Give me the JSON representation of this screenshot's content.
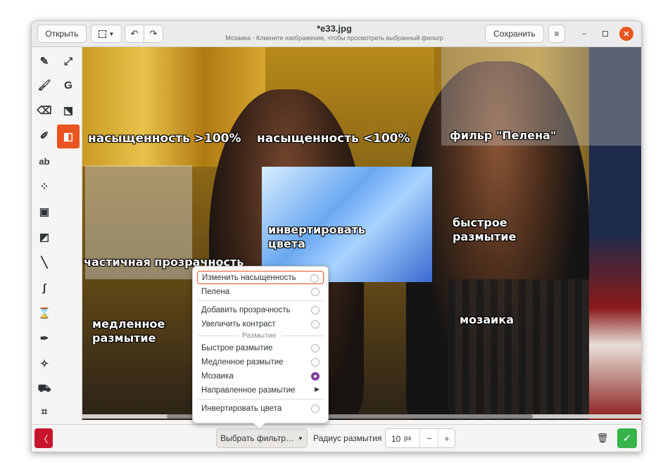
{
  "header": {
    "open_label": "Открыть",
    "save_label": "Сохранить",
    "title": "*e33.jpg",
    "subtitle": "Мозаика - Кликните изображение, чтобы просмотреть выбранный фильтр"
  },
  "canvas_labels": {
    "saturation_up": "насыщенность >100%",
    "saturation_down": "насыщенность <100%",
    "veil": "фильр \"Пелена\"",
    "invert_line1": "инвертировать",
    "invert_line2": "цвета",
    "fast_blur_line1": "быстрое",
    "fast_blur_line2": "размытие",
    "partial_transparency": "частичная прозрачность",
    "slow_blur_line1": "медленное",
    "slow_blur_line2": "размытие",
    "mosaic": "мозаика"
  },
  "filter_menu": {
    "items": [
      {
        "label": "Изменить насыщенность"
      },
      {
        "label": "Пелена"
      },
      {
        "label": "Добавить прозрачность"
      },
      {
        "label": "Увеличить контраст"
      },
      {
        "label": "Быстрое размытие"
      },
      {
        "label": "Медленное размытие"
      },
      {
        "label": "Мозаика"
      },
      {
        "label": "Направленное размытие"
      },
      {
        "label": "Инвертировать цвета"
      }
    ],
    "section_blur": "Размытие",
    "selected": "Мозаика"
  },
  "bottom": {
    "filter_button": "Выбрать фильтр…",
    "radius_label": "Радиус размытия",
    "radius_value": "10",
    "radius_unit": "px",
    "minus": "−",
    "plus": "+"
  },
  "colors": {
    "accent": "#e95420",
    "cancel": "#c7162b",
    "apply": "#38b44a",
    "selected_radio": "#813d9c"
  }
}
